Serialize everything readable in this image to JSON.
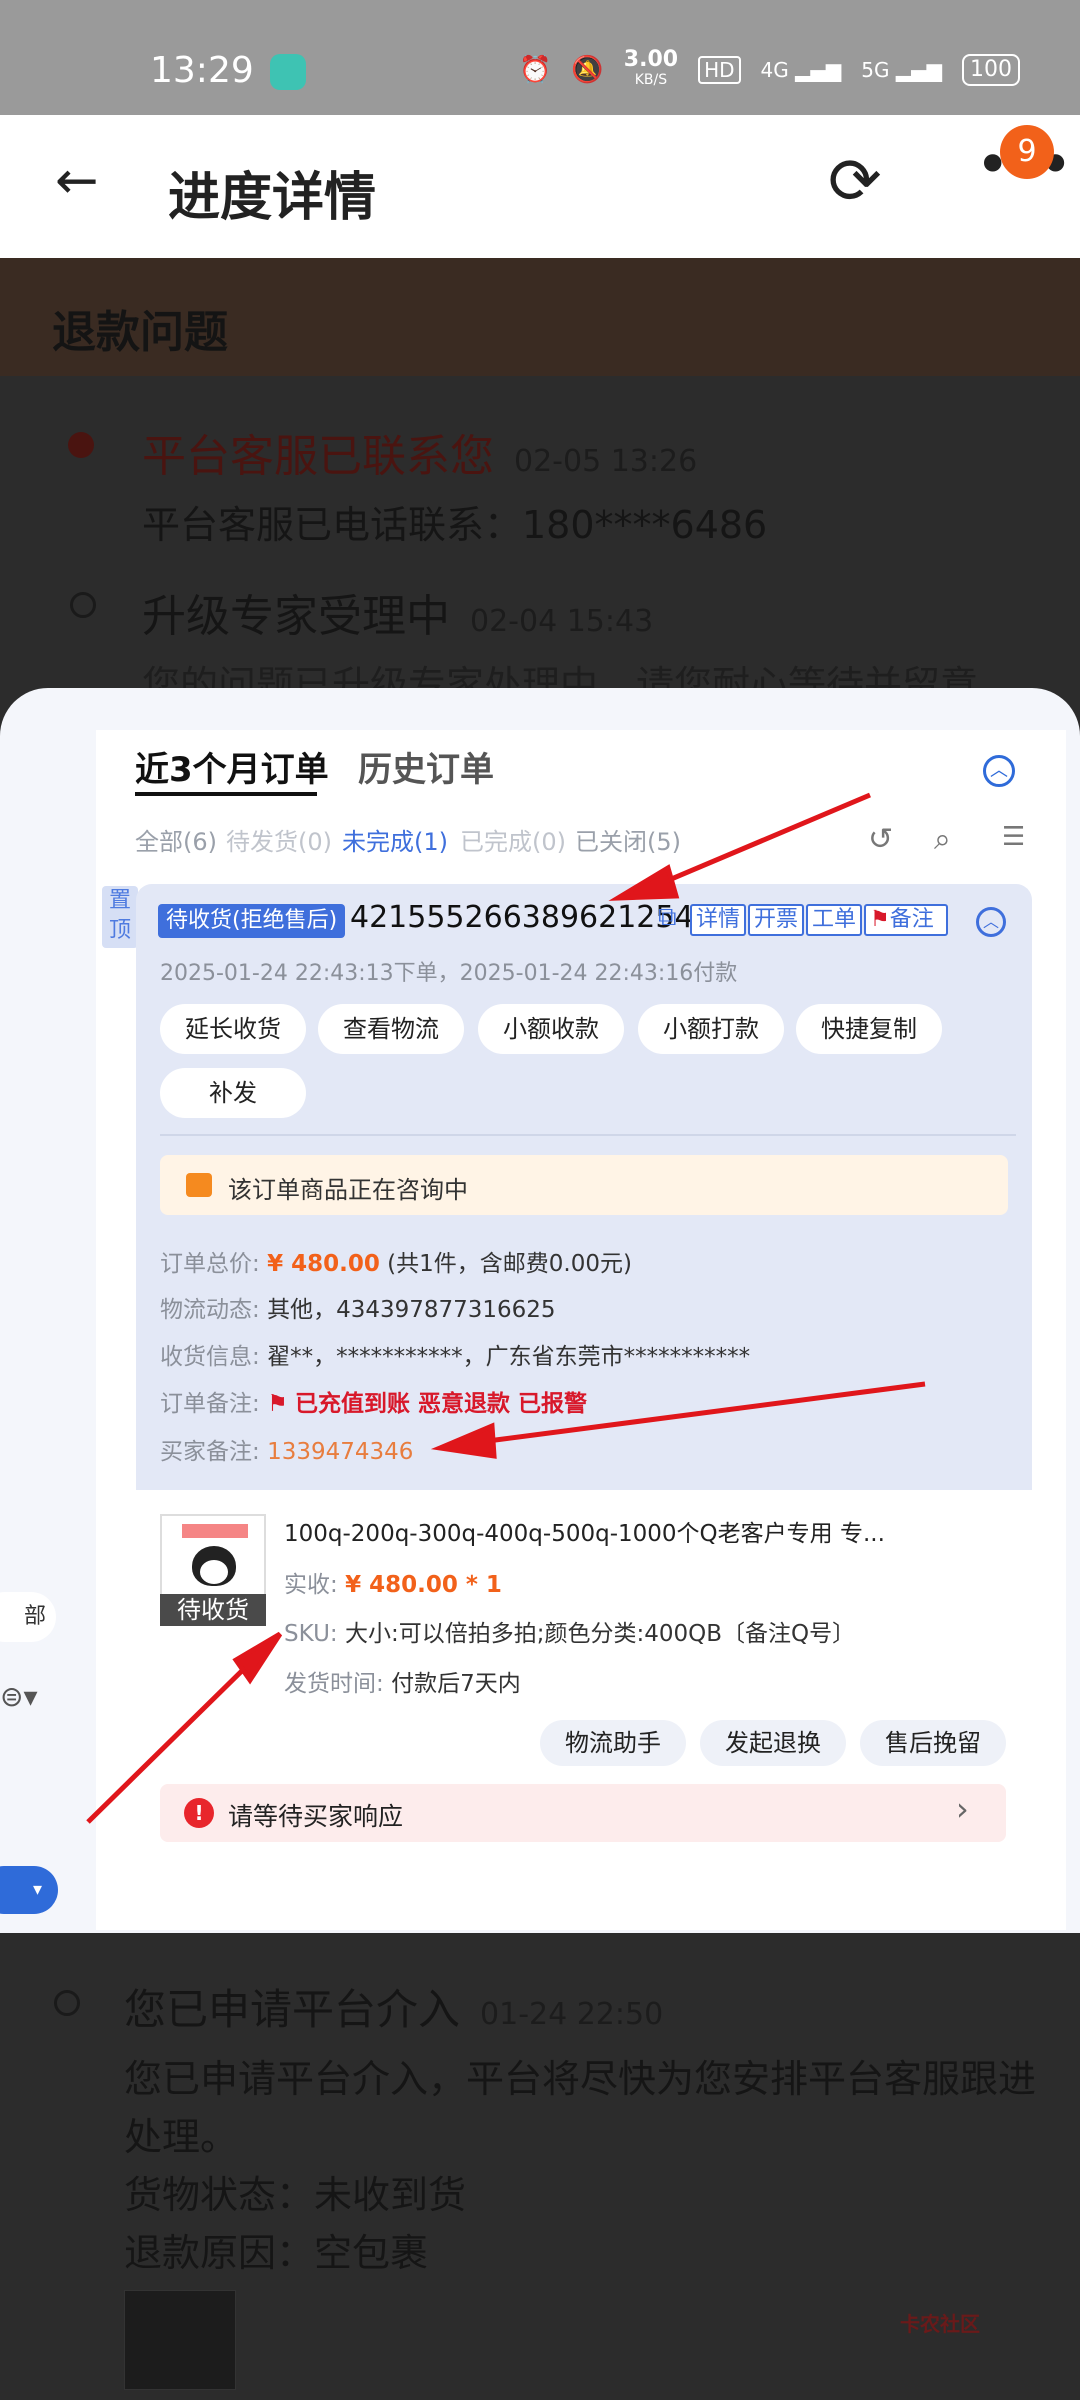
{
  "status_bar": {
    "time": "13:29",
    "network_speed": "3.00",
    "network_unit": "KB/S",
    "hd": "HD",
    "net1": "4G",
    "net2": "5G",
    "battery": "100"
  },
  "header": {
    "title": "进度详情",
    "more_badge": "9"
  },
  "background": {
    "section_title": "退款问题",
    "events": [
      {
        "title": "平台客服已联系您",
        "time": "02-05 13:26",
        "detail": "平台客服已电话联系：180****6486"
      },
      {
        "title": "升级专家受理中",
        "time": "02-04 15:43",
        "detail": "您的问题已升级专家处理中，请您耐心等待并留意"
      }
    ],
    "lower_event": {
      "title": "您已申请平台介入",
      "time": "01-24 22:50",
      "detail_line1": "您已申请平台介入，平台将尽快为您安排平台客服跟进",
      "detail_line2": "处理。",
      "goods_status": "货物状态：未收到货",
      "refund_reason": "退款原因：空包裹"
    },
    "watermark": "卡农社区"
  },
  "overlay": {
    "tabs": [
      "近3个月订单",
      "历史订单"
    ],
    "filters": [
      "全部(6)",
      "待发货(0)",
      "未完成(1)",
      "已完成(0)",
      "已关闭(5)"
    ],
    "pin_label": "置顶",
    "order": {
      "status_tag": "待收货(拒绝售后)",
      "order_no": "4215552663896212543",
      "actions": [
        "详情",
        "开票",
        "工单",
        "备注"
      ],
      "dates": "2025-01-24 22:43:13下单，2025-01-24 22:43:16付款",
      "buttons": [
        "延长收货",
        "查看物流",
        "小额收款",
        "小额打款",
        "快捷复制",
        "补发"
      ],
      "consult_text": "该订单商品正在咨询中",
      "total_label": "订单总价:",
      "total_value": "¥ 480.00",
      "total_note": "(共1件，含邮费0.00元)",
      "logistics_label": "物流动态:",
      "logistics_value": "其他，434397877316625",
      "receiver_label": "收货信息:",
      "receiver_value": "翟**，***********，广东省东莞市***********",
      "note_label": "订单备注:",
      "note_value": "已充值到账 恶意退款 已报警",
      "buyer_note_label": "买家备注:",
      "buyer_note_value": "1339474346"
    },
    "product": {
      "image_label": "待收货",
      "name": "100q-200q-300q-400q-500q-1000个Q老客户专用 专...",
      "paid_label": "实收:",
      "paid_value": "¥ 480.00 * 1",
      "sku_label": "SKU:",
      "sku_value": "大小:可以倍拍多拍;颜色分类:400QB〔备注Q号〕",
      "ship_label": "发货时间:",
      "ship_value": "付款后7天内",
      "buttons": [
        "物流助手",
        "发起退换",
        "售后挽留"
      ],
      "alert": "请等待买家响应"
    },
    "left_fragment": "部"
  },
  "colors": {
    "accent_blue": "#3f6fdc",
    "price_orange": "#f2611a",
    "flag_red": "#d8182a",
    "annotation_arrow": "#e0161b"
  }
}
